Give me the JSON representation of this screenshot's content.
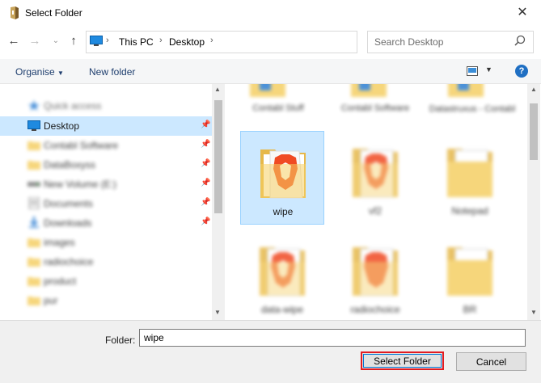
{
  "window": {
    "title": "Select Folder",
    "close_glyph": "✕"
  },
  "address_bar": {
    "crumbs": [
      "This PC",
      "Desktop"
    ],
    "separator": "›"
  },
  "search": {
    "placeholder": "Search Desktop"
  },
  "toolbar": {
    "organise_label": "Organise",
    "new_folder_label": "New folder",
    "help_glyph": "?"
  },
  "nav_pane": {
    "items": [
      {
        "label": "Quick access",
        "pinned": false,
        "icon": "star-icon"
      },
      {
        "label": "Desktop",
        "pinned": true,
        "icon": "desktop-icon"
      },
      {
        "label": "Contabl Software",
        "pinned": true,
        "icon": "folder-icon"
      },
      {
        "label": "DataBoxyss",
        "pinned": true,
        "icon": "folder-icon"
      },
      {
        "label": "New Volume (E:)",
        "pinned": true,
        "icon": "drive-icon"
      },
      {
        "label": "Documents",
        "pinned": true,
        "icon": "documents-icon"
      },
      {
        "label": "Downloads",
        "pinned": true,
        "icon": "download-icon"
      },
      {
        "label": "images",
        "pinned": false,
        "icon": "folder-icon"
      },
      {
        "label": "radiochoice",
        "pinned": false,
        "icon": "folder-icon"
      },
      {
        "label": "product",
        "pinned": false,
        "icon": "folder-icon"
      },
      {
        "label": "pur",
        "pinned": false,
        "icon": "folder-icon"
      }
    ]
  },
  "content": {
    "top_row_labels": [
      "Contabl Stuff",
      "Contabl Software",
      "Datastruxus - Contabl"
    ],
    "tiles": [
      {
        "label": "wipe",
        "selected": true
      },
      {
        "label": "vf2",
        "selected": false
      },
      {
        "label": "Notepad",
        "selected": false
      },
      {
        "label": "data-wipe",
        "selected": false
      },
      {
        "label": "radiochoice",
        "selected": false
      },
      {
        "label": "BR",
        "selected": false
      }
    ]
  },
  "footer": {
    "folder_label": "Folder:",
    "folder_value": "wipe",
    "select_button": "Select Folder",
    "cancel_button": "Cancel"
  },
  "colors": {
    "accent": "#0078d7",
    "highlight": "#e11b22",
    "selection": "#cce8ff",
    "folder_yellow": "#f5cf65",
    "brave_orange": "#f04a23"
  }
}
